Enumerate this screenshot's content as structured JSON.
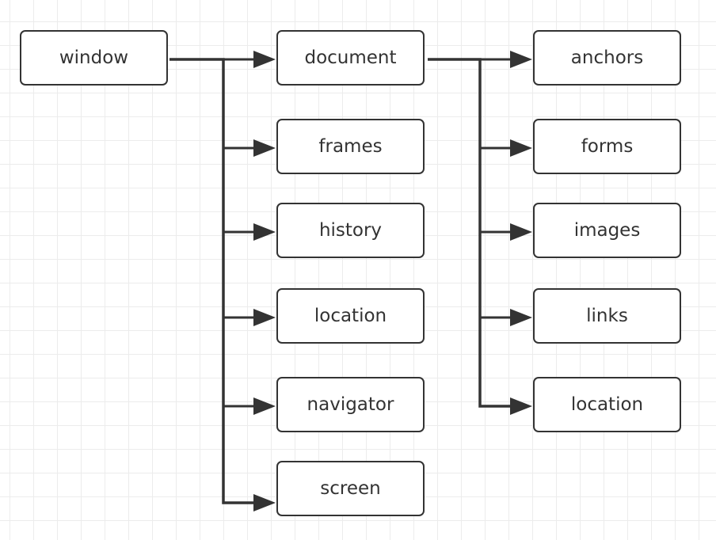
{
  "diagram": {
    "root": "window",
    "window_children": [
      "document",
      "frames",
      "history",
      "location",
      "navigator",
      "screen"
    ],
    "document_children": [
      "anchors",
      "forms",
      "images",
      "links",
      "location"
    ],
    "line_color": "#333333"
  }
}
